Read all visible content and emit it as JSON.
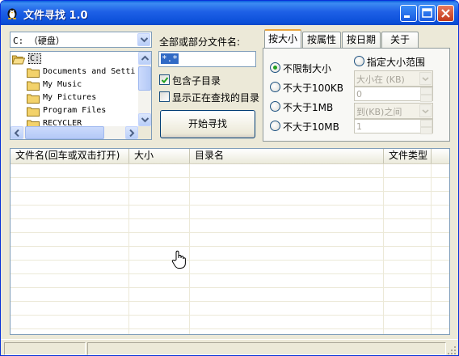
{
  "window": {
    "title": "文件寻找 1.0"
  },
  "drive": {
    "selected": "C: （硬盘）"
  },
  "tree": {
    "items": [
      {
        "label": "C:"
      },
      {
        "label": "Documents and Setti"
      },
      {
        "label": "My Music"
      },
      {
        "label": "My Pictures"
      },
      {
        "label": "Program Files"
      },
      {
        "label": "RECYCLER"
      }
    ]
  },
  "search": {
    "filename_label": "全部或部分文件名:",
    "filename_value": "*.*",
    "include_subdirs_label": "包含子目录",
    "include_subdirs_checked": true,
    "show_current_dir_label": "显示正在查找的目录",
    "show_current_dir_checked": false,
    "start_button": "开始寻找"
  },
  "tabs": [
    {
      "label": "按大小",
      "active": true
    },
    {
      "label": "按属性",
      "active": false
    },
    {
      "label": "按日期",
      "active": false
    },
    {
      "label": "关于",
      "active": false
    }
  ],
  "size_panel": {
    "options": [
      {
        "label": "不限制大小",
        "selected": true
      },
      {
        "label": "不大于100KB",
        "selected": false
      },
      {
        "label": "不大于1MB",
        "selected": false
      },
      {
        "label": "不大于10MB",
        "selected": false
      }
    ],
    "range_label": "指定大小范围",
    "range_from_combo": "大小在 (KB)",
    "range_from_value": "0",
    "range_to_combo": "到(KB)之间",
    "range_to_value": "1"
  },
  "results": {
    "columns": [
      "文件名(回车或双击打开)",
      "大小",
      "目录名",
      "文件类型"
    ],
    "rows": []
  },
  "colors": {
    "titlebar": "#0a5fde",
    "selection": "#316ac5",
    "window_bg": "#ece9d8"
  }
}
